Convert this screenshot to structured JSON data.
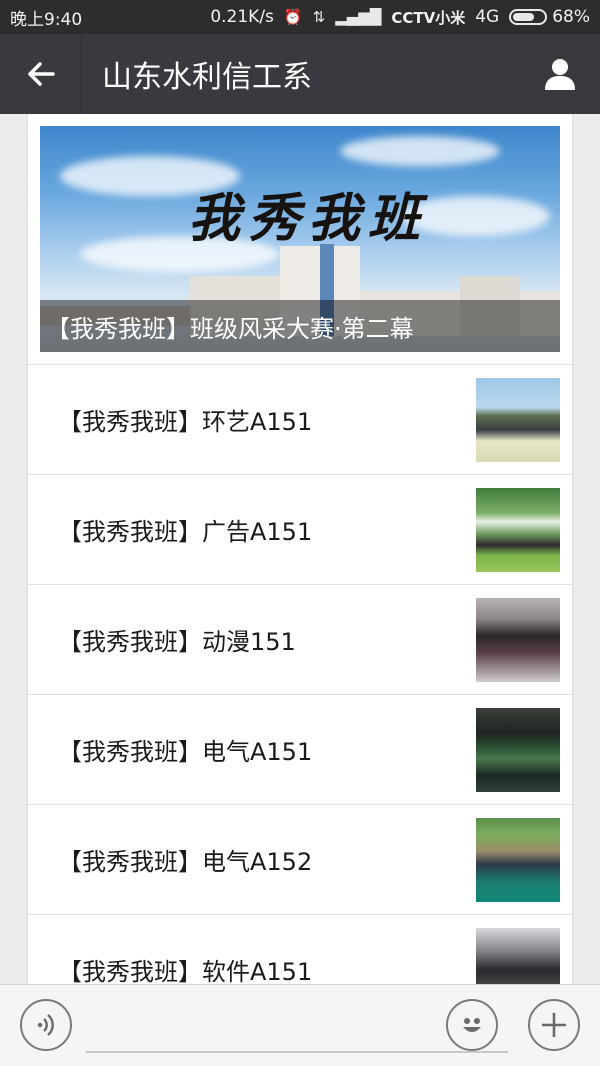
{
  "status_bar": {
    "time": "晚上9:40",
    "speed": "0.21K/s",
    "carrier": "CCTV小米",
    "network": "4G",
    "battery": "68%",
    "battery_level": 0.68
  },
  "header": {
    "title": "山东水利信工系",
    "back_icon": "arrow-left-icon",
    "profile_icon": "person-icon"
  },
  "cover": {
    "calligraphy": "我秀我班",
    "caption": "【我秀我班】班级风采大赛·第二幕"
  },
  "articles": [
    {
      "title": "【我秀我班】环艺A151",
      "thumb": "group-photo-field"
    },
    {
      "title": "【我秀我班】广告A151",
      "thumb": "group-photo-grass"
    },
    {
      "title": "【我秀我班】动漫151",
      "thumb": "group-photo-indoor"
    },
    {
      "title": "【我秀我班】电气A151",
      "thumb": "group-photo-court"
    },
    {
      "title": "【我秀我班】电气A152",
      "thumb": "group-photo-formation"
    },
    {
      "title": "【我秀我班】软件A151",
      "thumb": "group-photo-night"
    }
  ],
  "bottom_bar": {
    "voice_icon": "voice-icon",
    "emoji_icon": "emoji-icon",
    "add_icon": "plus-icon"
  },
  "colors": {
    "header_bg": "#393a3f",
    "status_bg": "#2d2d2d",
    "page_bg": "#ebebeb"
  }
}
